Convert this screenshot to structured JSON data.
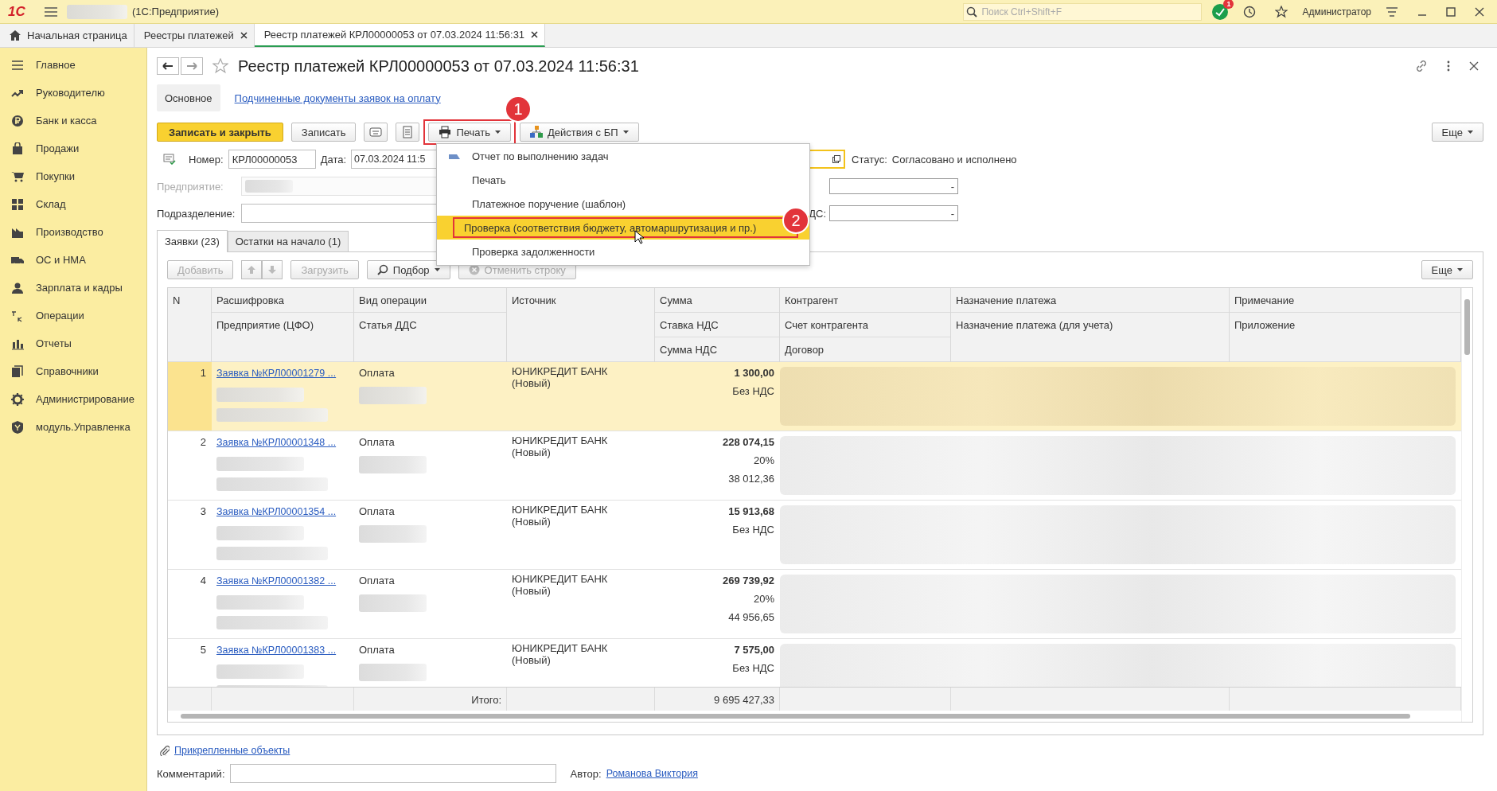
{
  "app_bar": {
    "logo": "1С",
    "app_name": "(1С:Предприятие)",
    "search": {
      "placeholder": "Поиск Ctrl+Shift+F"
    },
    "notification_count": "1",
    "user": "Администратор"
  },
  "tabs": [
    {
      "label": "Начальная страница",
      "kind": "home",
      "selected": false
    },
    {
      "label": "Реестры платежей",
      "kind": "document",
      "selected": false
    },
    {
      "label": "Реестр платежей КРЛ00000053 от 07.03.2024 11:56:31",
      "kind": "document",
      "selected": true
    }
  ],
  "sidebar": {
    "items": [
      {
        "label": "Главное"
      },
      {
        "label": "Руководителю"
      },
      {
        "label": "Банк и касса"
      },
      {
        "label": "Продажи"
      },
      {
        "label": "Покупки"
      },
      {
        "label": "Склад"
      },
      {
        "label": "Производство"
      },
      {
        "label": "ОС и НМА"
      },
      {
        "label": "Зарплата и кадры"
      },
      {
        "label": "Операции"
      },
      {
        "label": "Отчеты"
      },
      {
        "label": "Справочники"
      },
      {
        "label": "Администрирование"
      },
      {
        "label": "модуль.Управленка"
      }
    ]
  },
  "form": {
    "title": "Реестр платежей КРЛ00000053 от 07.03.2024 11:56:31",
    "tabs": [
      {
        "label": "Основное",
        "selected": true
      },
      {
        "label": "Подчиненные документы заявок на оплату",
        "selected": false
      }
    ],
    "toolbar": [
      {
        "kind": "primary",
        "label": "Записать и закрыть"
      },
      {
        "kind": "plain",
        "label": "Записать"
      },
      {
        "kind": "keyboard"
      },
      {
        "kind": "list"
      },
      {
        "kind": "print_menu",
        "label": "Печать",
        "callout": "1"
      },
      {
        "kind": "process_menu",
        "label": "Действия с БП"
      }
    ],
    "more": "Еще"
  },
  "fields": {
    "number": {
      "label": "Номер:",
      "value": "КРЛ00000053"
    },
    "date": {
      "label": "Дата:",
      "value": "07.03.2024 11:5"
    },
    "status": {
      "label": "Статус:",
      "value": "Согласовано и исполнено"
    },
    "enterprise": {
      "label": "Предприятие:",
      "disabled": true
    },
    "division": {
      "label": "Подразделение:"
    },
    "right_field": {
      "value": "-"
    },
    "vat_field": {
      "label": "ДС:",
      "value": "-"
    }
  },
  "menu": {
    "items": [
      {
        "label": "Отчет по выполнению задач",
        "kind": "report",
        "selected": false
      },
      {
        "label": "Печать",
        "kind": "plain",
        "selected": false
      },
      {
        "label": "Платежное поручение (шаблон)",
        "kind": "plain",
        "selected": false
      },
      {
        "label": "Проверка (соответствия бюджету, автомаршрутизация и пр.)",
        "kind": "plain",
        "selected": true,
        "callout": "2"
      },
      {
        "label": "Проверка задолженности",
        "kind": "plain",
        "selected": false
      }
    ]
  },
  "list_tabs": [
    {
      "label": "Заявки (23)",
      "selected": true
    },
    {
      "label": "Остатки на начало (1)",
      "selected": false
    }
  ],
  "list_toolbar": [
    {
      "kind": "text",
      "label": "Добавить",
      "disabled": true
    },
    {
      "kind": "up",
      "disabled": true
    },
    {
      "kind": "down",
      "disabled": true
    },
    {
      "kind": "text",
      "label": "Загрузить",
      "disabled": true
    },
    {
      "kind": "search_menu",
      "label": "Подбор",
      "disabled": false
    },
    {
      "kind": "cancel",
      "label": "Отменить строку",
      "disabled": true
    }
  ],
  "list_more": "Еще",
  "table": {
    "columns": [
      {
        "lines": [
          "N"
        ]
      },
      {
        "lines": [
          "Расшифровка",
          "Предприятие (ЦФО)"
        ]
      },
      {
        "lines": [
          "Вид операции",
          "Статья ДДС"
        ]
      },
      {
        "lines": [
          "Источник"
        ]
      },
      {
        "lines": [
          "Сумма",
          "Ставка НДС",
          "Сумма НДС"
        ]
      },
      {
        "lines": [
          "Контрагент",
          "Счет контрагента",
          "Договор"
        ]
      },
      {
        "lines": [
          "Назначение платежа",
          "Назначение платежа (для учета)"
        ]
      },
      {
        "lines": [
          "Примечание",
          "Приложение"
        ]
      }
    ],
    "rows": [
      {
        "n": "1",
        "selected": true,
        "link": "Заявка №КРЛ00001279 ...",
        "operation": "Оплата",
        "source": "ЮНИКРЕДИТ БАНК",
        "source_note": "(Новый)",
        "amount": "1 300,00",
        "vat_rate": "Без НДС"
      },
      {
        "n": "2",
        "selected": false,
        "link": "Заявка №КРЛ00001348 ...",
        "operation": "Оплата",
        "source": "ЮНИКРЕДИТ БАНК",
        "source_note": "(Новый)",
        "amount": "228 074,15",
        "vat_rate": "20%",
        "vat_amount": "38 012,36"
      },
      {
        "n": "3",
        "selected": false,
        "link": "Заявка №КРЛ00001354 ...",
        "operation": "Оплата",
        "source": "ЮНИКРЕДИТ БАНК",
        "source_note": "(Новый)",
        "amount": "15 913,68",
        "vat_rate": "Без НДС"
      },
      {
        "n": "4",
        "selected": false,
        "link": "Заявка №КРЛ00001382 ...",
        "operation": "Оплата",
        "source": "ЮНИКРЕДИТ БАНК",
        "source_note": "(Новый)",
        "amount": "269 739,92",
        "vat_rate": "20%",
        "vat_amount": "44 956,65"
      },
      {
        "n": "5",
        "selected": false,
        "link": "Заявка №КРЛ00001383 ...",
        "operation": "Оплата",
        "source": "ЮНИКРЕДИТ БАНК",
        "source_note": "(Новый)",
        "amount": "7 575,00",
        "vat_rate": "Без НДС"
      }
    ],
    "totals": {
      "label": "Итого:",
      "amount": "9 695 427,33"
    }
  },
  "footer": {
    "attachments": "Прикрепленные объекты",
    "comment": {
      "label": "Комментарий:"
    },
    "author": {
      "label": "Автор:",
      "value": "Романова Виктория"
    }
  }
}
